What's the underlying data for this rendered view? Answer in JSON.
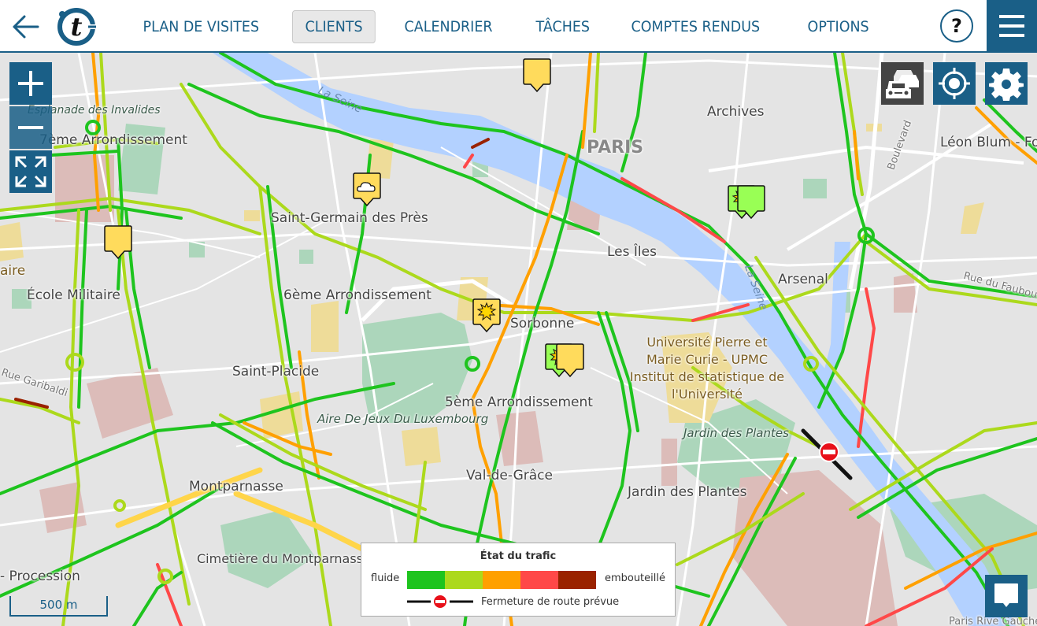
{
  "header": {
    "back_icon": "arrow-left-icon",
    "logo_letter": "t",
    "nav": [
      {
        "label": "PLAN DE VISITES",
        "active": false
      },
      {
        "label": "CLIENTS",
        "active": true
      },
      {
        "label": "CALENDRIER",
        "active": false
      },
      {
        "label": "TÂCHES",
        "active": false
      },
      {
        "label": "COMPTES RENDUS",
        "active": false
      },
      {
        "label": "OPTIONS",
        "active": false
      }
    ],
    "help_label": "?",
    "menu_icon": "hamburger-icon"
  },
  "map": {
    "controls": {
      "zoom_in_icon": "plus-icon",
      "zoom_out_icon": "minus-icon",
      "fullscreen_icon": "expand-icon",
      "traffic_icon": "traffic-cars-icon",
      "locate_icon": "crosshair-icon",
      "settings_icon": "gear-icon"
    },
    "labels": [
      {
        "text": "Esplanade des Invalides",
        "kind": "park"
      },
      {
        "text": "7ème Arrondissement",
        "kind": "district"
      },
      {
        "text": "La Seine",
        "kind": "water"
      },
      {
        "text": "PARIS",
        "kind": "city"
      },
      {
        "text": "Archives",
        "kind": "district"
      },
      {
        "text": "Léon Blum - Folie",
        "kind": "district"
      },
      {
        "text": "Saint-Germain des Près",
        "kind": "district"
      },
      {
        "text": "Les Îles",
        "kind": "district"
      },
      {
        "text": "Arsenal",
        "kind": "district"
      },
      {
        "text": "La Seine",
        "kind": "water"
      },
      {
        "text": "Boulevard",
        "kind": "street"
      },
      {
        "text": "aire",
        "kind": "district"
      },
      {
        "text": "École Militaire",
        "kind": "district"
      },
      {
        "text": "6ème Arrondissement",
        "kind": "district"
      },
      {
        "text": "Sorbonne",
        "kind": "district"
      },
      {
        "text": "Université Pierre et Marie Curie - UPMC Institut de statistique de l'Université",
        "kind": "university"
      },
      {
        "text": "Saint-Placide",
        "kind": "district"
      },
      {
        "text": "5ème Arrondissement",
        "kind": "district"
      },
      {
        "text": "Aire De Jeux Du Luxembourg",
        "kind": "park"
      },
      {
        "text": "Jardin des Plantes",
        "kind": "park"
      },
      {
        "text": "Val-de-Grâce",
        "kind": "district"
      },
      {
        "text": "Jardin des Plantes",
        "kind": "district"
      },
      {
        "text": "Montparnasse",
        "kind": "district"
      },
      {
        "text": "Cimetière du Montparnasse",
        "kind": "district"
      },
      {
        "text": "- Procession",
        "kind": "district"
      },
      {
        "text": "Rue du Faubourg",
        "kind": "street"
      },
      {
        "text": "Rue Garibaldi",
        "kind": "street"
      },
      {
        "text": "Paris Rive Gauche",
        "kind": "district"
      }
    ],
    "markers": [
      {
        "name": "client-marker",
        "color": "#ffdb5c",
        "weather": "none"
      },
      {
        "name": "client-marker",
        "color": "#ffdb5c",
        "weather": "cloud"
      },
      {
        "name": "client-marker",
        "color": "#ffdb5c",
        "weather": "none"
      },
      {
        "name": "client-marker",
        "color": "#ffdb5c",
        "weather": "sun"
      },
      {
        "name": "client-marker",
        "color": "#99ff55",
        "weather": "sun"
      },
      {
        "name": "client-marker",
        "color": "#ffdb5c",
        "weather": "none"
      },
      {
        "name": "client-marker",
        "color": "#99ff55",
        "weather": "sun"
      },
      {
        "name": "client-marker",
        "color": "#99ff55",
        "weather": "none"
      }
    ],
    "scale_label": "500 m",
    "chat_icon": "chat-bubble-icon"
  },
  "legend": {
    "title": "État du trafic",
    "low_label": "fluide",
    "high_label": "embouteillé",
    "colors": [
      "#1ec41e",
      "#acd91c",
      "#ffa000",
      "#ff4848",
      "#9a2200"
    ],
    "closure_label": "Fermeture de route prévue",
    "closure_icon": "no-entry-icon"
  },
  "colors": {
    "brand": "#1a5f87",
    "water": "#b3d1ff",
    "park": "#acd6bb",
    "land": "#e4e4e4"
  }
}
